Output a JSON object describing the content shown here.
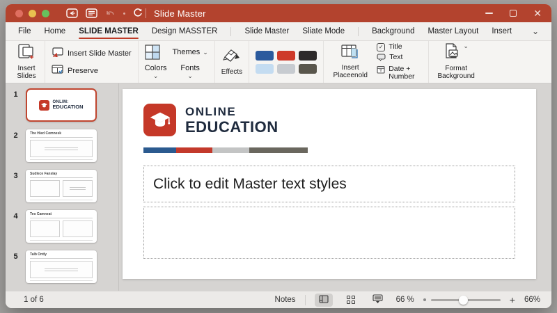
{
  "colors": {
    "titlebar_red": "#B3432E",
    "tab_accent_red": "#BE3A26",
    "logo_red": "#C53828",
    "logo_navy": "#1F2B3E",
    "thumbnail_selected_border": "#C0452F"
  },
  "icons": {
    "chevron_down": "⌄",
    "checkmark": "✓",
    "close": "✕"
  },
  "window": {
    "title": "Slide Master"
  },
  "tabs": [
    {
      "label": "File"
    },
    {
      "label": "Home"
    },
    {
      "label": "SLIDE MASTER",
      "active": true
    },
    {
      "label": "Design MASSTER"
    },
    {
      "label": "Slide Master"
    },
    {
      "label": "Sliate Mode"
    },
    {
      "label": "Background"
    },
    {
      "label": "Master Layout"
    },
    {
      "label": "Insert"
    }
  ],
  "ribbon": {
    "insert_slides": "Insert Slides",
    "insert_slide_master": "Insert Slide Master",
    "preserve": "Preserve",
    "themes": "Themes",
    "colors_label": "Colors",
    "fonts_label": "Fonts",
    "effects": "Effects",
    "swatches": [
      "#2B5A9D",
      "#CE3A2A",
      "#2D2A2A",
      "#C4DCF1",
      "#C7CBD0",
      "#59564C"
    ],
    "insert_placeholder": "Insert Placeenold",
    "title_check": "Title",
    "text_item": "Text",
    "date_item": "Date + Number",
    "format_background": "Format Background"
  },
  "thumbnails": [
    {
      "num": "1",
      "logo_line1": "ONLIM:",
      "logo_line2": "EDUCATION"
    },
    {
      "num": "2",
      "title": "The Hied Comnesk"
    },
    {
      "num": "3",
      "title": "Sudlece Fanslay"
    },
    {
      "num": "4",
      "title": "Teo Camneat"
    },
    {
      "num": "5",
      "title": "Talb Ontly"
    }
  ],
  "slide": {
    "logo_line1": "ONLINE",
    "logo_line2": "EDUCATION",
    "body_placeholder": "Click to edit Master text styles",
    "colorbar": [
      "#2B5A8F",
      "#C3392B",
      "#C3C4C4",
      "#6A675E"
    ]
  },
  "statusbar": {
    "page": "1 of 6",
    "notes": "Notes",
    "zoom_left": "66 %",
    "plus": "+",
    "zoom_right": "66%"
  }
}
